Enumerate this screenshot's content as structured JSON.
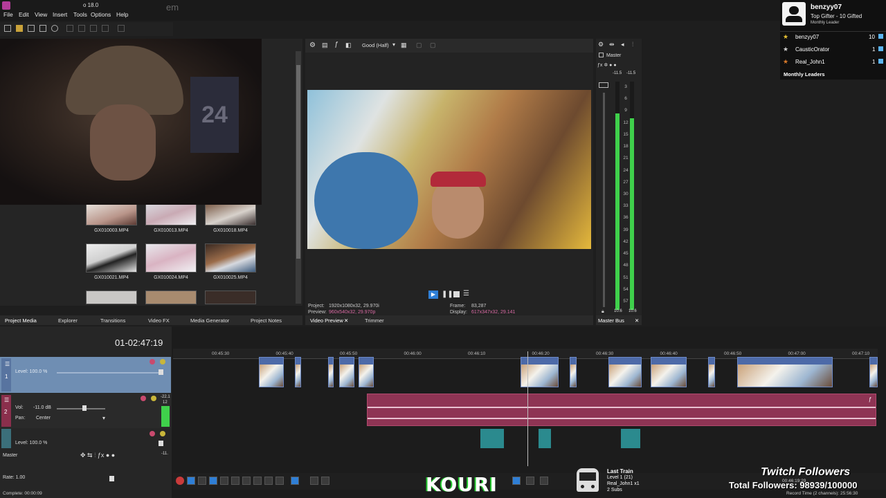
{
  "window": {
    "title_fragment": "o 18.0",
    "overlay_text": "em"
  },
  "menu": [
    "File",
    "Edit",
    "View",
    "Insert",
    "Tools",
    "Options",
    "Help"
  ],
  "media": {
    "thumbnails": [
      {
        "label": "GX010003.MP4",
        "icon": "video-thumbnail"
      },
      {
        "label": "GX010013.MP4",
        "icon": "video-thumbnail"
      },
      {
        "label": "GX010018.MP4",
        "icon": "video-thumbnail"
      },
      {
        "label": "GX010021.MP4",
        "icon": "video-thumbnail"
      },
      {
        "label": "GX010024.MP4",
        "icon": "video-thumbnail"
      },
      {
        "label": "GX010025.MP4",
        "icon": "video-thumbnail"
      }
    ],
    "tabs": [
      "Project Media",
      "Explorer",
      "Transitions",
      "Video FX",
      "Media Generator",
      "Project Notes"
    ]
  },
  "preview": {
    "quality": "Good (Half)",
    "project_label": "Project:",
    "project_value": "1920x1080x32, 29.970i",
    "preview_label": "Preview:",
    "preview_value": "960x540x32, 29.970p",
    "frame_label": "Frame:",
    "frame_value": "83,287",
    "display_label": "Display:",
    "display_value": "617x347x32, 29.141",
    "tabs": [
      "Video Preview",
      "Trimmer"
    ]
  },
  "master_bus": {
    "label": "Master",
    "peak_left": "-11.5",
    "peak_right": "-11.5",
    "scale": [
      "3",
      "6",
      "9",
      "12",
      "15",
      "18",
      "21",
      "24",
      "27",
      "30",
      "33",
      "36",
      "39",
      "42",
      "45",
      "48",
      "51",
      "54",
      "57"
    ],
    "bottom_left": "10.6",
    "bottom_right": "10.6",
    "tab": "Master Bus",
    "level_left": 0.86,
    "level_right": 0.84
  },
  "leaderboard": {
    "top_name": "benzyy07",
    "top_sub": "Top Gifter - 10 Gifted",
    "top_caption": "Monthly Leader",
    "rows": [
      {
        "name": "benzyy07",
        "count": "10"
      },
      {
        "name": "CausticOrator",
        "count": "1"
      },
      {
        "name": "Real_John1",
        "count": "1"
      }
    ],
    "footer": "Monthly Leaders",
    "colors": {
      "star1": "#e8c234",
      "star2": "#d0d0d0",
      "star3": "#d97a2a",
      "gift": "#5ab4f0"
    }
  },
  "timeline": {
    "timecode": "01-02:47:19",
    "ruler": [
      "00:45:30",
      "00:45:40",
      "00:45:50",
      "00:46:00",
      "00:46:10",
      "00:46:20",
      "00:46:30",
      "00:46:40",
      "00:46:50",
      "00:47:00",
      "00:47:10"
    ],
    "video_track": {
      "number": "1",
      "level_label": "Level: 100.0 %"
    },
    "audio_track": {
      "number": "2",
      "vol_label": "Vol:",
      "vol_value": "-11.0 dB",
      "pan_label": "Pan:",
      "pan_value": "Center",
      "meter_top": "-22.1",
      "meter_mark": "12"
    },
    "level_track": {
      "label": "Level: 100.0 %"
    },
    "master_label": "Master",
    "master_value": "-11.",
    "rate_label": "Rate: 1.00",
    "complete_label": "Complete: 00:00:09",
    "record_time": "Record Time (2 channels): 25:56:30",
    "end_time": "00:46:19;29"
  },
  "overlays": {
    "kouri": "KOURI",
    "now_playing_title": "Last Train",
    "now_playing_level": "Level 1 (21)",
    "now_playing_user": "Real_John1 x1",
    "now_playing_subs": "2 Subs",
    "followers_title": "Twitch Followers",
    "followers_count": "Total Followers: 98939/100000"
  }
}
